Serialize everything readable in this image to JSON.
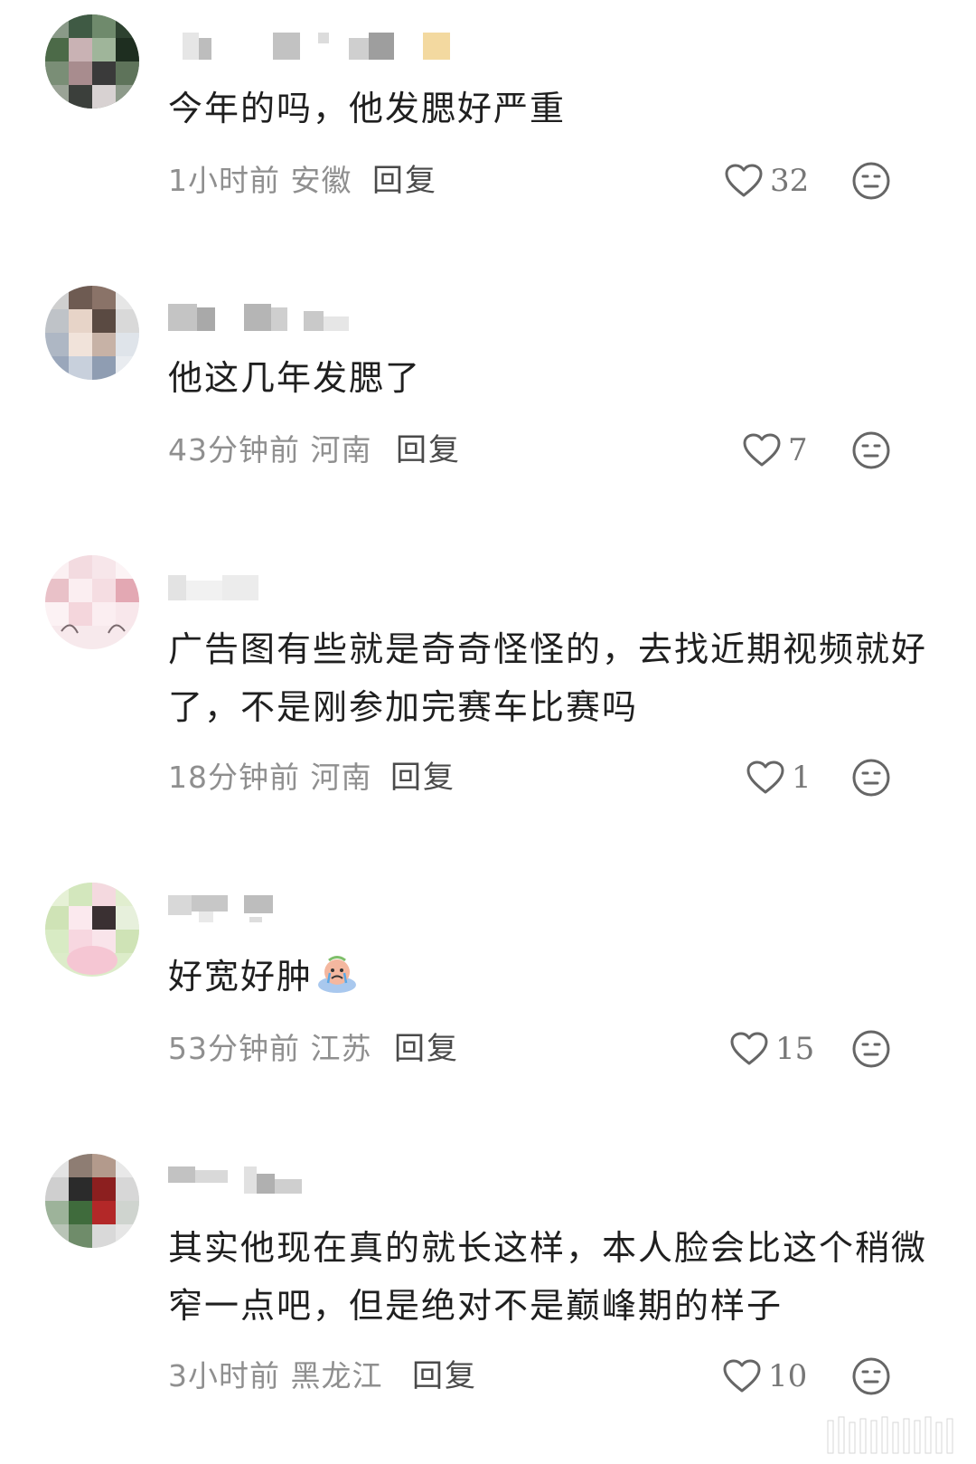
{
  "comments": [
    {
      "text": "今年的吗，他发腮好严重",
      "time_location": "1小时前 安徽",
      "reply_label": "回复",
      "like_count": "32"
    },
    {
      "text": "他这几年发腮了",
      "time_location": "43分钟前 河南",
      "reply_label": "回复",
      "like_count": "7"
    },
    {
      "text": "广告图有些就是奇奇怪怪的，去找近期视频就好了，不是刚参加完赛车比赛吗",
      "time_location": "18分钟前 河南",
      "reply_label": "回复",
      "like_count": "1"
    },
    {
      "text": "好宽好肿",
      "time_location": "53分钟前 江苏",
      "reply_label": "回复",
      "like_count": "15"
    },
    {
      "text": "其实他现在真的就长这样，本人脸会比这个稍微窄一点吧，但是绝对不是巅峰期的样子",
      "time_location": "3小时前 黑龙江",
      "reply_label": "回复",
      "like_count": "10"
    }
  ],
  "icons": {
    "like": "heart-outline-icon",
    "dislike": "neutral-face-icon",
    "emoji": "crying-emoji-icon"
  },
  "colors": {
    "text_primary": "#1f1f1f",
    "text_meta": "#8f8f8f",
    "reply": "#4a4a4a",
    "icon_stroke": "#666666"
  }
}
